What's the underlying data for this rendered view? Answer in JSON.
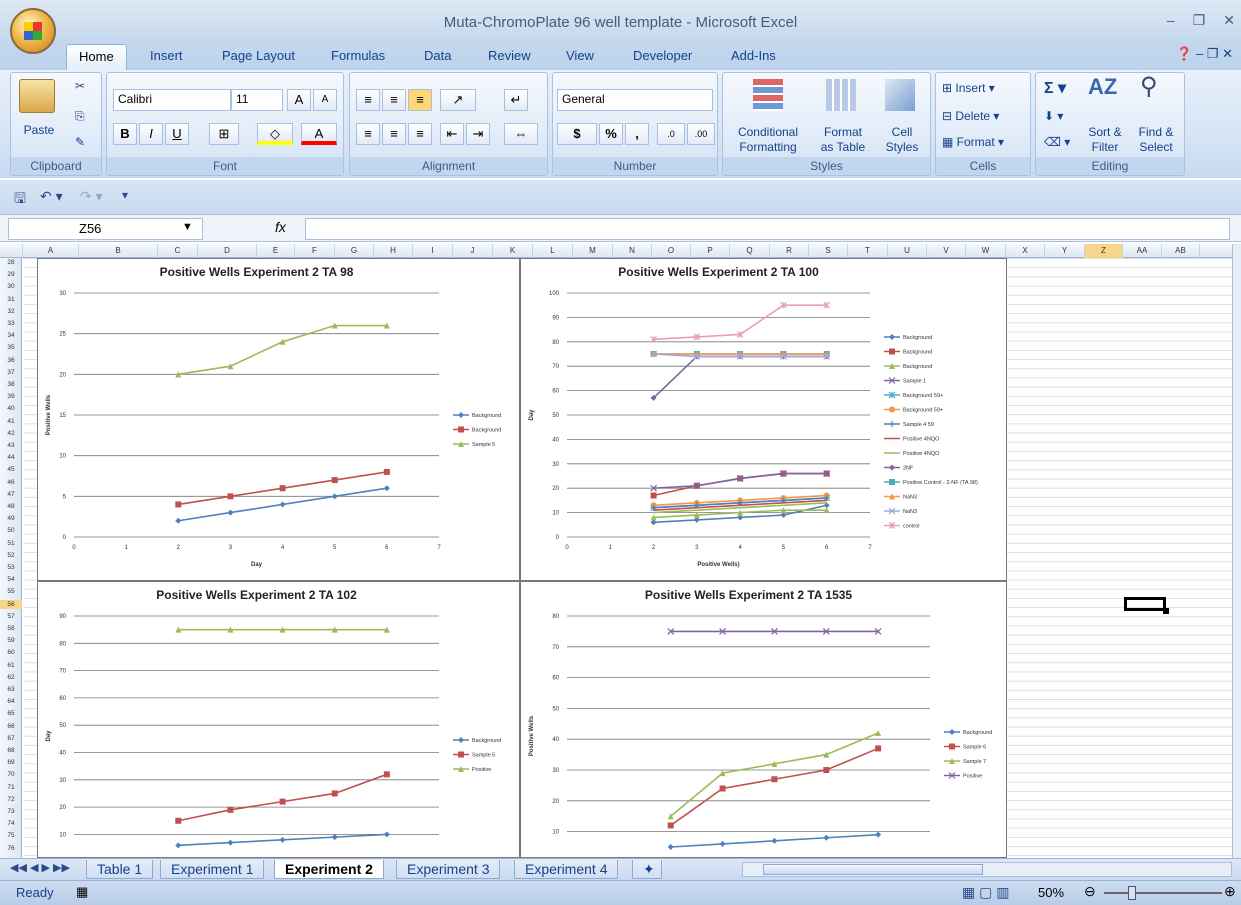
{
  "window": {
    "title": "Muta-ChromoPlate 96 well template - Microsoft Excel"
  },
  "ribbon": {
    "tabs": [
      "Home",
      "Insert",
      "Page Layout",
      "Formulas",
      "Data",
      "Review",
      "View",
      "Developer",
      "Add-Ins"
    ],
    "clipboard": {
      "label": "Clipboard",
      "paste": "Paste"
    },
    "font": {
      "label": "Font",
      "name": "Calibri",
      "size": "11",
      "bold": "B",
      "italic": "I",
      "underline": "U"
    },
    "alignment": {
      "label": "Alignment"
    },
    "number": {
      "label": "Number",
      "format": "General",
      "currency": "$",
      "percent": "%",
      "comma": ","
    },
    "styles": {
      "label": "Styles",
      "conditional": "Conditional",
      "conditional2": "Formatting",
      "format_as": "Format",
      "format_as2": "as Table",
      "cell_styles": "Cell",
      "cell_styles2": "Styles"
    },
    "cells": {
      "label": "Cells",
      "insert": "Insert",
      "delete": "Delete",
      "format": "Format"
    },
    "editing": {
      "label": "Editing",
      "sort": "Sort &",
      "sort2": "Filter",
      "find": "Find &",
      "find2": "Select"
    }
  },
  "formula_bar": {
    "name_box": "Z56",
    "fx": "fx",
    "value": ""
  },
  "columns": [
    "A",
    "B",
    "C",
    "D",
    "E",
    "F",
    "G",
    "H",
    "I",
    "J",
    "K",
    "L",
    "M",
    "N",
    "O",
    "P",
    "Q",
    "R",
    "S",
    "T",
    "U",
    "V",
    "W",
    "X",
    "Y",
    "Z",
    "AA",
    "AB"
  ],
  "selected_column": "Z",
  "rows": {
    "start": 28,
    "end": 76,
    "selected": 56
  },
  "sheet_tabs": [
    "Table 1",
    "Experiment 1",
    "Experiment 2",
    "Experiment 3",
    "Experiment 4"
  ],
  "active_sheet": "Experiment 2",
  "status": {
    "ready": "Ready",
    "zoom": "50%"
  },
  "chart_data": [
    {
      "type": "line",
      "title": "Positive Wells Experiment 2 TA 98",
      "xlabel": "Day",
      "ylabel": "Positive Wells",
      "xlim": [
        0,
        7
      ],
      "ylim": [
        0,
        30
      ],
      "xticks": [
        0,
        1,
        2,
        3,
        4,
        5,
        6,
        7
      ],
      "yticks": [
        0,
        5,
        10,
        15,
        20,
        25,
        30
      ],
      "x": [
        2,
        3,
        4,
        5,
        6
      ],
      "legend": "right",
      "series": [
        {
          "name": "Background",
          "color": "#4f81bd",
          "marker": "diamond",
          "values": [
            2,
            3,
            4,
            5,
            6
          ]
        },
        {
          "name": "Background",
          "color": "#c0504d",
          "marker": "square",
          "values": [
            4,
            5,
            6,
            7,
            8
          ]
        },
        {
          "name": "Sample 5",
          "color": "#9bbb59",
          "marker": "triangle",
          "values": [
            20,
            21,
            24,
            26,
            26
          ]
        }
      ]
    },
    {
      "type": "line",
      "title": "Positive Wells Experiment 2 TA 100",
      "xlabel": "Positive Wells)",
      "ylabel": "Day",
      "xlim": [
        0,
        7
      ],
      "ylim": [
        0,
        100
      ],
      "xticks": [
        0,
        1,
        2,
        3,
        4,
        5,
        6,
        7
      ],
      "yticks": [
        0,
        10,
        20,
        30,
        40,
        50,
        60,
        70,
        80,
        90,
        100
      ],
      "x": [
        2,
        3,
        4,
        5,
        6
      ],
      "legend": "right",
      "series": [
        {
          "name": "Background",
          "color": "#4f81bd",
          "marker": "diamond",
          "values": [
            6,
            7,
            8,
            9,
            13
          ]
        },
        {
          "name": "Background",
          "color": "#c0504d",
          "marker": "square",
          "values": [
            17,
            21,
            24,
            26,
            26
          ]
        },
        {
          "name": "Background",
          "color": "#9bbb59",
          "marker": "triangle",
          "values": [
            8,
            9,
            10,
            11,
            11
          ]
        },
        {
          "name": "Sample 1",
          "color": "#8064a2",
          "marker": "x",
          "values": [
            20,
            21,
            24,
            26,
            26
          ]
        },
        {
          "name": "Background 59+",
          "color": "#4bacc6",
          "marker": "star",
          "values": [
            12,
            13,
            14,
            15,
            16
          ]
        },
        {
          "name": "Background 59+",
          "color": "#f79646",
          "marker": "circle",
          "values": [
            13,
            14,
            15,
            16,
            17
          ]
        },
        {
          "name": "Sample 4 59",
          "color": "#4f81bd",
          "marker": "plus",
          "values": [
            12,
            13,
            14,
            15,
            16
          ]
        },
        {
          "name": "Positive 4NQO",
          "color": "#c0504d",
          "marker": "none",
          "values": [
            11,
            12,
            13,
            14,
            15
          ]
        },
        {
          "name": "Positive 4NQO",
          "color": "#9bbb59",
          "marker": "none",
          "values": [
            10,
            11,
            12,
            13,
            14
          ]
        },
        {
          "name": "2NF",
          "color": "#8064a2",
          "marker": "diamond",
          "values": [
            57,
            74,
            74,
            74,
            74
          ]
        },
        {
          "name": "Positive Control - 2-NF (TA 98)",
          "color": "#4bacc6",
          "marker": "square",
          "values": [
            75,
            75,
            75,
            75,
            75
          ]
        },
        {
          "name": "NaN3",
          "color": "#f79646",
          "marker": "triangle",
          "values": [
            75,
            75,
            75,
            75,
            75
          ]
        },
        {
          "name": "NaN3",
          "color": "#a5a5d8",
          "marker": "x",
          "values": [
            75,
            74,
            74,
            74,
            74
          ]
        },
        {
          "name": "control",
          "color": "#e6a0b4",
          "marker": "star",
          "values": [
            81,
            82,
            83,
            95,
            95
          ]
        }
      ]
    },
    {
      "type": "line",
      "title": "Positive Wells Experiment 2 TA 102",
      "xlabel": "",
      "ylabel": "Day",
      "ylim": [
        0,
        90
      ],
      "yticks": [
        10,
        20,
        30,
        40,
        50,
        60,
        70,
        80,
        90
      ],
      "x": [
        2,
        3,
        4,
        5,
        6
      ],
      "legend": "right",
      "series": [
        {
          "name": "Background",
          "color": "#4f81bd",
          "marker": "diamond",
          "values": [
            6,
            7,
            8,
            9,
            10
          ]
        },
        {
          "name": "Sample 5",
          "color": "#c0504d",
          "marker": "square",
          "values": [
            15,
            19,
            22,
            25,
            32
          ]
        },
        {
          "name": "Positive",
          "color": "#9bbb59",
          "marker": "triangle",
          "values": [
            85,
            85,
            85,
            85,
            85
          ]
        }
      ]
    },
    {
      "type": "line",
      "title": "Positive Wells Experiment 2 TA 1535",
      "xlabel": "",
      "ylabel": "Positive Wells",
      "ylim": [
        0,
        80
      ],
      "yticks": [
        10,
        20,
        30,
        40,
        50,
        60,
        70,
        80
      ],
      "x": [
        2,
        3,
        4,
        5,
        6
      ],
      "legend": "right",
      "series": [
        {
          "name": "Background",
          "color": "#4f81bd",
          "marker": "diamond",
          "values": [
            5,
            6,
            7,
            8,
            9
          ]
        },
        {
          "name": "Sample 6",
          "color": "#c0504d",
          "marker": "square",
          "values": [
            12,
            24,
            27,
            30,
            37
          ]
        },
        {
          "name": "Sample 7",
          "color": "#9bbb59",
          "marker": "triangle",
          "values": [
            15,
            29,
            32,
            35,
            42
          ]
        },
        {
          "name": "Positive",
          "color": "#8064a2",
          "marker": "x",
          "values": [
            75,
            75,
            75,
            75,
            75
          ]
        }
      ]
    }
  ]
}
